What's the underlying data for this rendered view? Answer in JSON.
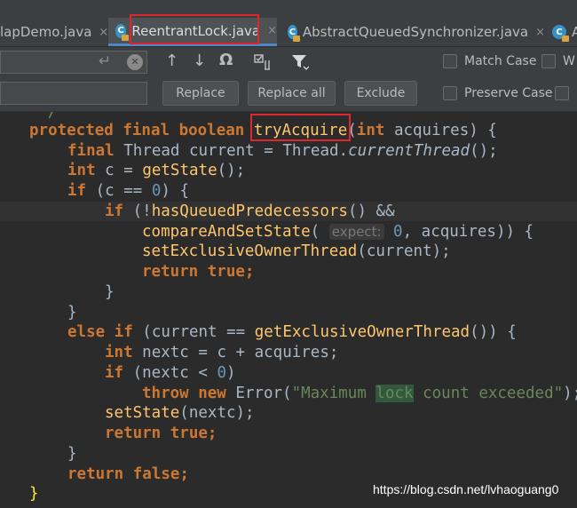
{
  "tabs": [
    {
      "label": "lapDemo.java",
      "close": "×"
    },
    {
      "label": "ReentrantLock.java",
      "close": "×"
    },
    {
      "label": "AbstractQueuedSynchronizer.java",
      "close": "×"
    },
    {
      "label": "Al",
      "close": ""
    }
  ],
  "find": {
    "enter_glyph": "↵",
    "clear_glyph": "✕"
  },
  "toolbar": {
    "up": "↑",
    "down": "↓",
    "find_all": "Ω"
  },
  "buttons": {
    "replace": "Replace",
    "replace_all": "Replace all",
    "exclude": "Exclude"
  },
  "options": {
    "match_case": "Match Case",
    "words": "W",
    "preserve_case": "Preserve Case"
  },
  "code": {
    "line0": "*/",
    "l1_kw": "protected final boolean ",
    "l1_method": "tryAcquire",
    "l1_paren": "(",
    "l1_kw2": "int ",
    "l1_rest": "acquires) {",
    "l2_kw": "final ",
    "l2_a": "Thread current = Thread.",
    "l2_it": "currentThread",
    "l2_b": "();",
    "l3_kw": "int ",
    "l3_a": "c = ",
    "l3_fn": "getState",
    "l3_b": "();",
    "l4_kw": "if ",
    "l4_a": "(c == ",
    "l4_num": "0",
    "l4_b": ") {",
    "l5_kw": "if ",
    "l5_a": "(!",
    "l5_fn": "hasQueuedPredecessors",
    "l5_b": "() &&",
    "l6_fn": "compareAndSetState",
    "l6_a": "( ",
    "l6_hint": "expect:",
    "l6_num": " 0",
    "l6_b": ", acquires)) {",
    "l7_fn": "setExclusiveOwnerThread",
    "l7_a": "(current);",
    "l8_kw": "return true",
    "l8_a": ";",
    "brace": "}",
    "l11_kw": "else if ",
    "l11_a": "(current == ",
    "l11_fn": "getExclusiveOwnerThread",
    "l11_b": "()) {",
    "l12_kw": "int ",
    "l12_a": "nextc = c + acquires;",
    "l13_kw": "if ",
    "l13_a": "(nextc < ",
    "l13_num": "0",
    "l13_b": ")",
    "l14_kw": "throw new ",
    "l14_a": "Error(",
    "l14_s1": "\"Maximum ",
    "l14_s2": "lock",
    "l14_s3": " count exceeded\"",
    "l14_b": ");",
    "l15_fn": "setState",
    "l15_a": "(nextc);",
    "l18_kw": "return false",
    "l18_a": ";"
  },
  "watermark": "https://blog.csdn.net/lvhaoguang0"
}
